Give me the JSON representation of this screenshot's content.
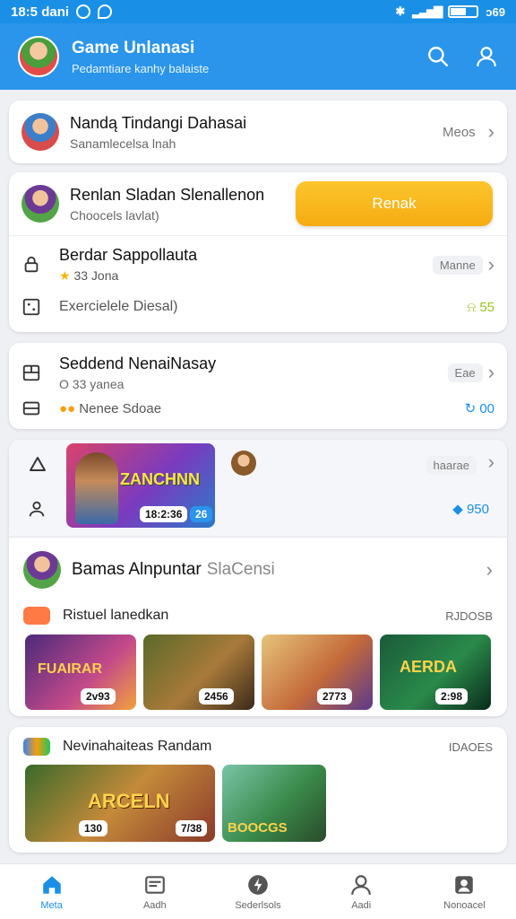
{
  "status_bar": {
    "time": "18:5 dani",
    "battery": "ɔ69"
  },
  "header": {
    "title": "Game Unlanasi",
    "subtitle": "Pedamtiare kanhy balaiste"
  },
  "profile_card": {
    "name": "Nandą Tindangi Dahasai",
    "sub": "Sanamlecelsa lnah",
    "more": "Meos"
  },
  "play_card": {
    "title": "Renlan Sladan Slenallenon",
    "sub": "Choocels lavlat)",
    "button": "Renak",
    "line1_title": "Berdar Sappollauta",
    "line1_meta": "33 Jona",
    "line1_pill": "Manne",
    "line2_text": "Exercielele Diesal)",
    "line2_value": "55"
  },
  "second_card": {
    "title": "Seddend NenaiNasay",
    "meta": "O 33 yanea",
    "sub": "Nenee Sdoae",
    "pill": "Eae",
    "value": "00"
  },
  "featured_card": {
    "thumb_title": "ZANCHNN",
    "thumb_count": "18:2:36",
    "thumb_tag": "26",
    "pill": "haarae",
    "value": "950"
  },
  "section1": {
    "title": "Bamas Alnpuntar",
    "title_extra": "SlaCensi",
    "subhead": "Ristuel lanedkan",
    "subhead_right": "RJDOSB",
    "games": [
      {
        "label": "FUAIRAR",
        "count": "2v93"
      },
      {
        "label": "",
        "count": "2456"
      },
      {
        "label": "",
        "count": "2773"
      },
      {
        "label": "AERDA",
        "count": "2:98"
      }
    ]
  },
  "section2": {
    "title": "Nevinahaiteas Randam",
    "right": "IDAOES",
    "games": [
      {
        "label": "ARCELN",
        "count": "130",
        "count2": "7/38"
      },
      {
        "label": "BOOCGS",
        "count": ""
      }
    ]
  },
  "nav": {
    "items": [
      {
        "label": "Meta",
        "icon": "home-icon"
      },
      {
        "label": "Aadh",
        "icon": "news-icon"
      },
      {
        "label": "Sederlsols",
        "icon": "bolt-icon"
      },
      {
        "label": "Aadi",
        "icon": "profile-icon"
      },
      {
        "label": "Nonoacel",
        "icon": "account-icon"
      }
    ]
  },
  "colors": {
    "primary": "#2a95ea",
    "accent": "#f5ac12",
    "success": "#9cc21d",
    "link": "#1a8fe6"
  }
}
